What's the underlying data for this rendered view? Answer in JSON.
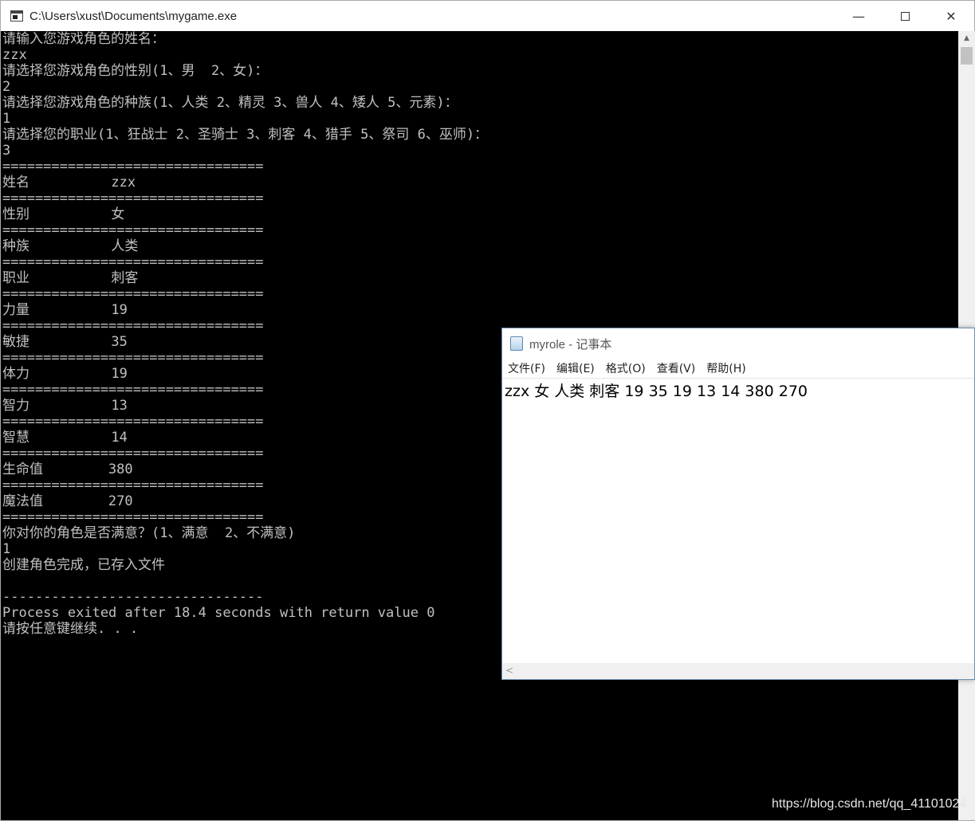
{
  "console": {
    "title": "C:\\Users\\xust\\Documents\\mygame.exe",
    "controls": {
      "minimize": "—",
      "maximize": "",
      "close": "✕"
    },
    "lines": [
      "请输入您游戏角色的姓名：",
      "zzx",
      "请选择您游戏角色的性别(1、男  2、女)：",
      "2",
      "请选择您游戏角色的种族(1、人类 2、精灵 3、兽人 4、矮人 5、元素)：",
      "1",
      "请选择您的职业(1、狂战士 2、圣骑士 3、刺客 4、猎手 5、祭司 6、巫师)：",
      "3",
      "================================",
      "姓名          zzx",
      "================================",
      "性别          女",
      "================================",
      "种族          人类",
      "================================",
      "职业          刺客",
      "================================",
      "力量          19",
      "================================",
      "敏捷          35",
      "================================",
      "体力          19",
      "================================",
      "智力          13",
      "================================",
      "智慧          14",
      "================================",
      "生命值        380",
      "================================",
      "魔法值        270",
      "================================",
      "你对你的角色是否满意？(1、满意  2、不满意)",
      "1",
      "创建角色完成，已存入文件",
      "",
      "--------------------------------",
      "Process exited after 18.4 seconds with return value 0",
      "请按任意键继续. . ."
    ]
  },
  "notepad": {
    "title": "myrole - 记事本",
    "menu": [
      "文件(F)",
      "编辑(E)",
      "格式(O)",
      "查看(V)",
      "帮助(H)"
    ],
    "content": "zzx 女 人类 刺客 19 35 19 13 14 380 270"
  },
  "watermark": "https://blog.csdn.net/qq_41101024"
}
